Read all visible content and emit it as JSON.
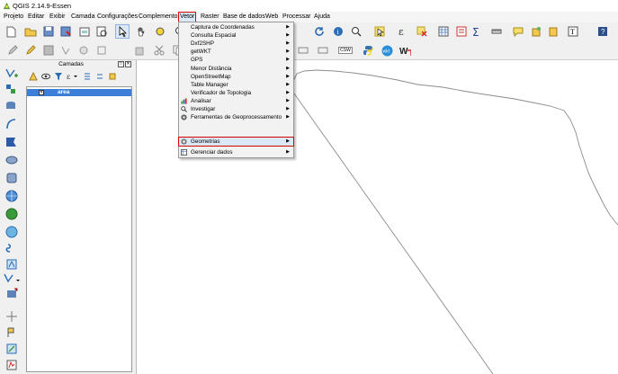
{
  "window": {
    "title": "QGIS 2.14.9-Essen"
  },
  "menubar": {
    "items": [
      "Projeto",
      "Editar",
      "Exibir",
      "Camada",
      "Configurações",
      "Complementos",
      "Vetor",
      "Raster",
      "Base de dados",
      "Web",
      "Processar",
      "Ajuda"
    ],
    "active": "Vetor"
  },
  "vector_menu": {
    "items": [
      {
        "label": "Captura de Coordenadas",
        "submenu": true
      },
      {
        "label": "Consulta Espacial",
        "submenu": true
      },
      {
        "label": "Dxf2SHP",
        "submenu": true
      },
      {
        "label": "getWKT",
        "submenu": true
      },
      {
        "label": "GPS",
        "submenu": true
      },
      {
        "label": "Menor Distância",
        "submenu": true
      },
      {
        "label": "OpenStreetMap",
        "submenu": true
      },
      {
        "label": "Table Manager",
        "submenu": true
      },
      {
        "label": "Verificador de Topologia",
        "submenu": true
      },
      {
        "label": "Analisar",
        "submenu": true,
        "icon": "analyze-icon"
      },
      {
        "label": "Investigar",
        "submenu": true,
        "icon": "research-icon"
      },
      {
        "label": "Ferramentas de Geoprocessamento",
        "submenu": true,
        "icon": "geoprocessing-icon"
      },
      {
        "label": "Geometrias",
        "submenu": true,
        "icon": "geometry-icon",
        "highlighted": true
      },
      {
        "label": "Gerenciar dados",
        "submenu": true,
        "icon": "manage-data-icon"
      }
    ],
    "submenu_arrow": "▶"
  },
  "layers_panel": {
    "title": "Camadas",
    "float_button": "□",
    "close_button": "✕",
    "layers": [
      {
        "name": "area",
        "checked": true,
        "check_mark": "✕"
      }
    ]
  },
  "toolbar_labels": {
    "csw": "CSW",
    "wkt": "wkt"
  },
  "colors": {
    "highlight_border": "#d40000",
    "selection": "#3b7fd9",
    "canvas": "#ffffff"
  }
}
